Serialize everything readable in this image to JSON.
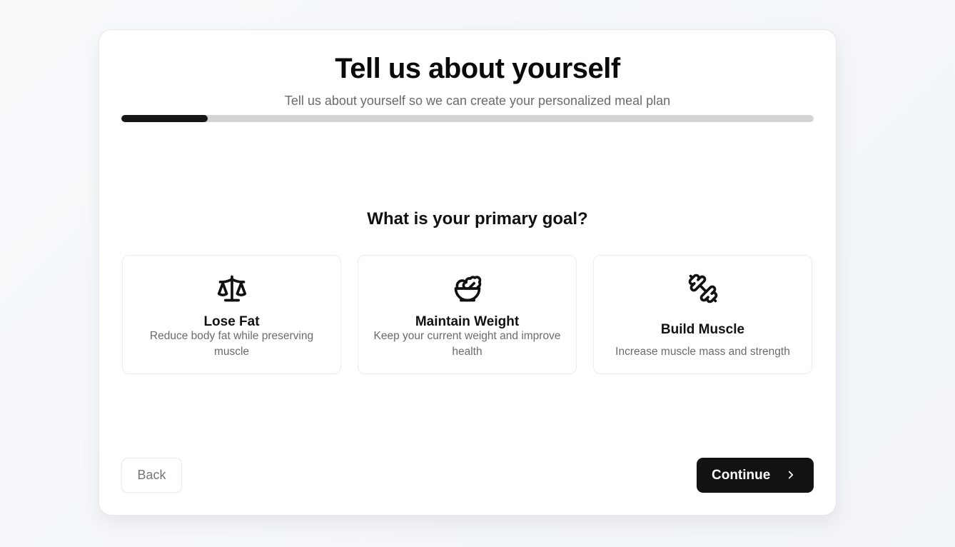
{
  "header": {
    "title": "Tell us about yourself",
    "subtitle": "Tell us about yourself so we can create your personalized meal plan"
  },
  "progress": {
    "fraction": 0.125
  },
  "question": "What is your primary goal?",
  "options": [
    {
      "label": "Lose Fat",
      "description": "Reduce body fat while preserving muscle",
      "icon": "scale-icon"
    },
    {
      "label": "Maintain Weight",
      "description": "Keep your current weight and improve health",
      "icon": "salad-bowl-icon"
    },
    {
      "label": "Build Muscle",
      "description": "Increase muscle mass and strength",
      "icon": "dumbbell-icon"
    }
  ],
  "nav": {
    "back_label": "Back",
    "continue_label": "Continue",
    "continue_icon": "chevron-right-icon"
  },
  "colors": {
    "primary_button": "#121212",
    "progress_fill": "#161616",
    "progress_track": "#d4d4d4",
    "muted_text": "#6b6b6b"
  }
}
